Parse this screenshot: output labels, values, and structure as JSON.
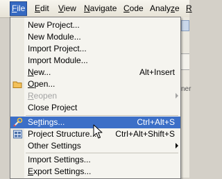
{
  "menubar": [
    {
      "label": "File",
      "mnemonic": "F",
      "rest": "ile",
      "active": true
    },
    {
      "label": "Edit",
      "mnemonic": "E",
      "rest": "dit"
    },
    {
      "label": "View",
      "mnemonic": "V",
      "rest": "iew"
    },
    {
      "label": "Navigate",
      "mnemonic": "N",
      "rest": "avigate"
    },
    {
      "label": "Code",
      "mnemonic": "C",
      "rest": "ode"
    },
    {
      "label": "Analyze",
      "pre": "Analy",
      "mnemonic": "z",
      "rest": "e"
    },
    {
      "label": "R",
      "mnemonic": "R",
      "rest": ""
    }
  ],
  "file_menu": [
    {
      "id": "new-project",
      "pre": "",
      "mn": "",
      "post": "New Project...",
      "shortcut": ""
    },
    {
      "id": "new-module",
      "pre": "New Module...",
      "mn": "",
      "post": "",
      "shortcut": ""
    },
    {
      "id": "import-project",
      "pre": "Import Project...",
      "mn": "",
      "post": "",
      "shortcut": ""
    },
    {
      "id": "import-module",
      "pre": "Import Module...",
      "mn": "",
      "post": "",
      "shortcut": ""
    },
    {
      "id": "new",
      "pre": "",
      "mn": "N",
      "post": "ew...",
      "shortcut": "Alt+Insert"
    },
    {
      "id": "open",
      "pre": "",
      "mn": "O",
      "post": "pen...",
      "shortcut": "",
      "icon": "folder-icon"
    },
    {
      "id": "reopen",
      "pre": "",
      "mn": "R",
      "post": "eopen",
      "shortcut": "",
      "disabled": true,
      "submenu": true
    },
    {
      "id": "close-project",
      "pre": "Close Project",
      "mn": "",
      "post": "",
      "shortcut": ""
    },
    {
      "id": "settings",
      "pre": "Se",
      "mn": "t",
      "post": "tings...",
      "shortcut": "Ctrl+Alt+S",
      "highlighted": true,
      "icon": "wrench-icon"
    },
    {
      "id": "project-structure",
      "pre": "Project Structure...",
      "mn": "",
      "post": "",
      "shortcut": "Ctrl+Alt+Shift+S",
      "icon": "project-structure-icon"
    },
    {
      "id": "other-settings",
      "pre": "Other Settings",
      "mn": "",
      "post": "",
      "shortcut": "",
      "submenu": true
    },
    {
      "id": "import-settings",
      "pre": "Import Settings...",
      "mn": "",
      "post": "",
      "shortcut": ""
    },
    {
      "id": "export-settings",
      "pre": "",
      "mn": "E",
      "post": "xport Settings...",
      "shortcut": ""
    }
  ],
  "colors": {
    "highlight": "#3c6fc7",
    "menubar_active": "#3569c1",
    "disabled_text": "#a3a3a3"
  },
  "background": {
    "fragment_text": "ner"
  }
}
